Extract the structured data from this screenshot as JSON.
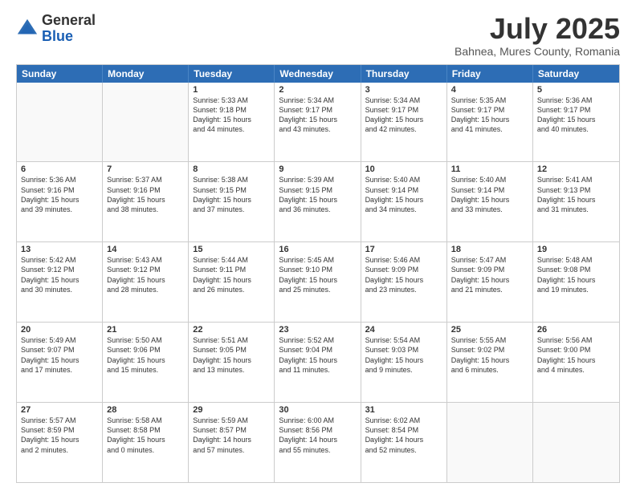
{
  "logo": {
    "general": "General",
    "blue": "Blue"
  },
  "title": "July 2025",
  "location": "Bahnea, Mures County, Romania",
  "days_of_week": [
    "Sunday",
    "Monday",
    "Tuesday",
    "Wednesday",
    "Thursday",
    "Friday",
    "Saturday"
  ],
  "weeks": [
    [
      {
        "day": "",
        "lines": []
      },
      {
        "day": "",
        "lines": []
      },
      {
        "day": "1",
        "lines": [
          "Sunrise: 5:33 AM",
          "Sunset: 9:18 PM",
          "Daylight: 15 hours",
          "and 44 minutes."
        ]
      },
      {
        "day": "2",
        "lines": [
          "Sunrise: 5:34 AM",
          "Sunset: 9:17 PM",
          "Daylight: 15 hours",
          "and 43 minutes."
        ]
      },
      {
        "day": "3",
        "lines": [
          "Sunrise: 5:34 AM",
          "Sunset: 9:17 PM",
          "Daylight: 15 hours",
          "and 42 minutes."
        ]
      },
      {
        "day": "4",
        "lines": [
          "Sunrise: 5:35 AM",
          "Sunset: 9:17 PM",
          "Daylight: 15 hours",
          "and 41 minutes."
        ]
      },
      {
        "day": "5",
        "lines": [
          "Sunrise: 5:36 AM",
          "Sunset: 9:17 PM",
          "Daylight: 15 hours",
          "and 40 minutes."
        ]
      }
    ],
    [
      {
        "day": "6",
        "lines": [
          "Sunrise: 5:36 AM",
          "Sunset: 9:16 PM",
          "Daylight: 15 hours",
          "and 39 minutes."
        ]
      },
      {
        "day": "7",
        "lines": [
          "Sunrise: 5:37 AM",
          "Sunset: 9:16 PM",
          "Daylight: 15 hours",
          "and 38 minutes."
        ]
      },
      {
        "day": "8",
        "lines": [
          "Sunrise: 5:38 AM",
          "Sunset: 9:15 PM",
          "Daylight: 15 hours",
          "and 37 minutes."
        ]
      },
      {
        "day": "9",
        "lines": [
          "Sunrise: 5:39 AM",
          "Sunset: 9:15 PM",
          "Daylight: 15 hours",
          "and 36 minutes."
        ]
      },
      {
        "day": "10",
        "lines": [
          "Sunrise: 5:40 AM",
          "Sunset: 9:14 PM",
          "Daylight: 15 hours",
          "and 34 minutes."
        ]
      },
      {
        "day": "11",
        "lines": [
          "Sunrise: 5:40 AM",
          "Sunset: 9:14 PM",
          "Daylight: 15 hours",
          "and 33 minutes."
        ]
      },
      {
        "day": "12",
        "lines": [
          "Sunrise: 5:41 AM",
          "Sunset: 9:13 PM",
          "Daylight: 15 hours",
          "and 31 minutes."
        ]
      }
    ],
    [
      {
        "day": "13",
        "lines": [
          "Sunrise: 5:42 AM",
          "Sunset: 9:12 PM",
          "Daylight: 15 hours",
          "and 30 minutes."
        ]
      },
      {
        "day": "14",
        "lines": [
          "Sunrise: 5:43 AM",
          "Sunset: 9:12 PM",
          "Daylight: 15 hours",
          "and 28 minutes."
        ]
      },
      {
        "day": "15",
        "lines": [
          "Sunrise: 5:44 AM",
          "Sunset: 9:11 PM",
          "Daylight: 15 hours",
          "and 26 minutes."
        ]
      },
      {
        "day": "16",
        "lines": [
          "Sunrise: 5:45 AM",
          "Sunset: 9:10 PM",
          "Daylight: 15 hours",
          "and 25 minutes."
        ]
      },
      {
        "day": "17",
        "lines": [
          "Sunrise: 5:46 AM",
          "Sunset: 9:09 PM",
          "Daylight: 15 hours",
          "and 23 minutes."
        ]
      },
      {
        "day": "18",
        "lines": [
          "Sunrise: 5:47 AM",
          "Sunset: 9:09 PM",
          "Daylight: 15 hours",
          "and 21 minutes."
        ]
      },
      {
        "day": "19",
        "lines": [
          "Sunrise: 5:48 AM",
          "Sunset: 9:08 PM",
          "Daylight: 15 hours",
          "and 19 minutes."
        ]
      }
    ],
    [
      {
        "day": "20",
        "lines": [
          "Sunrise: 5:49 AM",
          "Sunset: 9:07 PM",
          "Daylight: 15 hours",
          "and 17 minutes."
        ]
      },
      {
        "day": "21",
        "lines": [
          "Sunrise: 5:50 AM",
          "Sunset: 9:06 PM",
          "Daylight: 15 hours",
          "and 15 minutes."
        ]
      },
      {
        "day": "22",
        "lines": [
          "Sunrise: 5:51 AM",
          "Sunset: 9:05 PM",
          "Daylight: 15 hours",
          "and 13 minutes."
        ]
      },
      {
        "day": "23",
        "lines": [
          "Sunrise: 5:52 AM",
          "Sunset: 9:04 PM",
          "Daylight: 15 hours",
          "and 11 minutes."
        ]
      },
      {
        "day": "24",
        "lines": [
          "Sunrise: 5:54 AM",
          "Sunset: 9:03 PM",
          "Daylight: 15 hours",
          "and 9 minutes."
        ]
      },
      {
        "day": "25",
        "lines": [
          "Sunrise: 5:55 AM",
          "Sunset: 9:02 PM",
          "Daylight: 15 hours",
          "and 6 minutes."
        ]
      },
      {
        "day": "26",
        "lines": [
          "Sunrise: 5:56 AM",
          "Sunset: 9:00 PM",
          "Daylight: 15 hours",
          "and 4 minutes."
        ]
      }
    ],
    [
      {
        "day": "27",
        "lines": [
          "Sunrise: 5:57 AM",
          "Sunset: 8:59 PM",
          "Daylight: 15 hours",
          "and 2 minutes."
        ]
      },
      {
        "day": "28",
        "lines": [
          "Sunrise: 5:58 AM",
          "Sunset: 8:58 PM",
          "Daylight: 15 hours",
          "and 0 minutes."
        ]
      },
      {
        "day": "29",
        "lines": [
          "Sunrise: 5:59 AM",
          "Sunset: 8:57 PM",
          "Daylight: 14 hours",
          "and 57 minutes."
        ]
      },
      {
        "day": "30",
        "lines": [
          "Sunrise: 6:00 AM",
          "Sunset: 8:56 PM",
          "Daylight: 14 hours",
          "and 55 minutes."
        ]
      },
      {
        "day": "31",
        "lines": [
          "Sunrise: 6:02 AM",
          "Sunset: 8:54 PM",
          "Daylight: 14 hours",
          "and 52 minutes."
        ]
      },
      {
        "day": "",
        "lines": []
      },
      {
        "day": "",
        "lines": []
      }
    ]
  ]
}
